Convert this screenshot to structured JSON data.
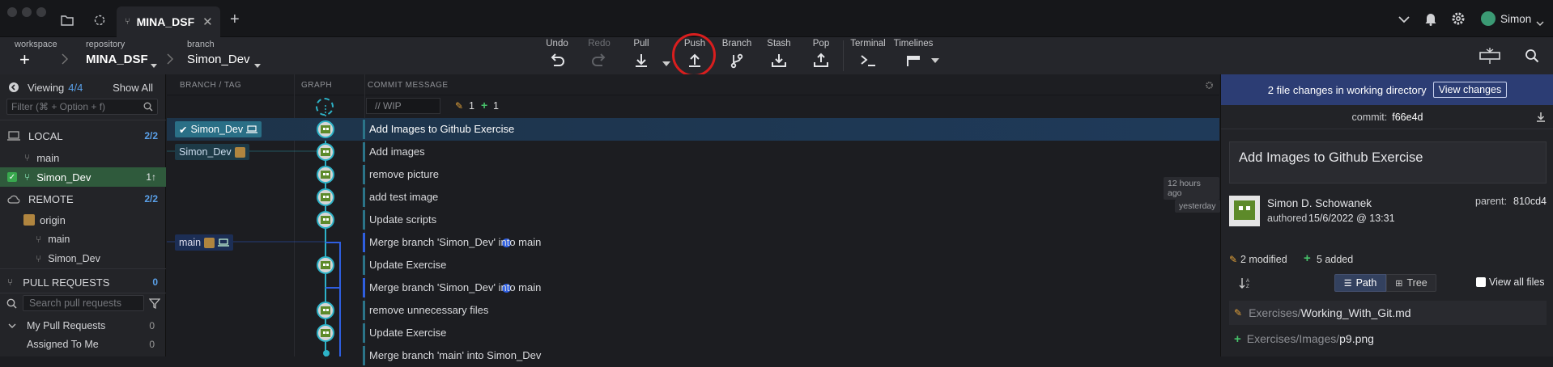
{
  "titlebar": {
    "tab_name": "MINA_DSF",
    "user_name": "Simon"
  },
  "breadcrumb": {
    "workspace_label": "workspace",
    "repository_label": "repository",
    "repository_value": "MINA_DSF",
    "branch_label": "branch",
    "branch_value": "Simon_Dev"
  },
  "toolbar": {
    "undo": "Undo",
    "redo": "Redo",
    "pull": "Pull",
    "push": "Push",
    "branch": "Branch",
    "stash": "Stash",
    "pop": "Pop",
    "terminal": "Terminal",
    "timelines": "Timelines"
  },
  "left": {
    "viewing_label": "Viewing",
    "viewing_count": "4/4",
    "show_all": "Show All",
    "filter_placeholder": "Filter (⌘ + Option + f)",
    "local_label": "LOCAL",
    "local_count": "2/2",
    "local_main": "main",
    "local_simon": "Simon_Dev",
    "local_simon_ahead": "1↑",
    "remote_label": "REMOTE",
    "remote_count": "2/2",
    "origin": "origin",
    "remote_main": "main",
    "remote_simon": "Simon_Dev",
    "pr_label": "PULL REQUESTS",
    "pr_count": "0",
    "pr_search_placeholder": "Search pull requests",
    "my_prs": "My Pull Requests",
    "my_prs_count": "0",
    "assigned": "Assigned To Me",
    "assigned_count": "0"
  },
  "graph": {
    "col_branch": "BRANCH / TAG",
    "col_graph": "GRAPH",
    "col_message": "COMMIT MESSAGE",
    "wip_placeholder": "// WIP",
    "wip_modified": "1",
    "wip_added": "1",
    "rows": [
      {
        "message": "Add Images to Github Exercise"
      },
      {
        "message": "Add images"
      },
      {
        "message": "remove picture"
      },
      {
        "message": "add test image"
      },
      {
        "message": "Update scripts"
      },
      {
        "message": "Merge branch 'Simon_Dev' into main"
      },
      {
        "message": "Update Exercise"
      },
      {
        "message": "Merge branch 'Simon_Dev' into main"
      },
      {
        "message": "remove unnecessary files"
      },
      {
        "message": "Update Exercise"
      },
      {
        "message": "Merge branch 'main' into Simon_Dev"
      }
    ],
    "tag_simon_local": "Simon_Dev",
    "tag_simon_remote": "Simon_Dev",
    "tag_main": "main",
    "time_12h": "12 hours ago",
    "time_yesterday": "yesterday"
  },
  "right": {
    "banner_text": "2 file changes in working directory",
    "view_changes": "View changes",
    "commit_label": "commit:",
    "commit_hash": "f66e4d",
    "commit_title": "Add Images to Github Exercise",
    "author_name": "Simon D. Schowanek",
    "authored_label": "authored",
    "authored_date": "15/6/2022 @ 13:31",
    "parent_label": "parent:",
    "parent_hash": "810cd4",
    "modified_text": "2 modified",
    "added_text": "5 added",
    "path_btn": "Path",
    "tree_btn": "Tree",
    "view_all": "View all files",
    "file1_dir": "Exercises/",
    "file1_name": "Working_With_Git.md",
    "file2_dir": "Exercises/Images/",
    "file2_name": "p9.png"
  },
  "colors": {
    "accent": "#2db3c8",
    "merge": "#2f5fe0",
    "banner": "#2c3d74",
    "push_highlight": "#d91e1e"
  }
}
